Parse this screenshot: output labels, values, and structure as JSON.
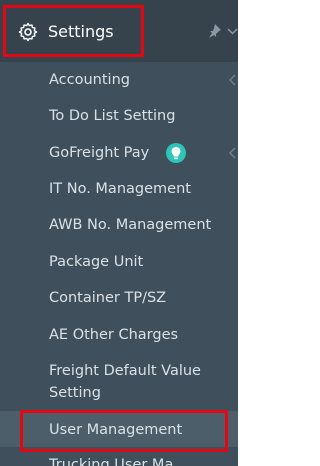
{
  "header": {
    "title": "Settings",
    "icon": "gear-icon",
    "pin_icon": "pin-icon"
  },
  "menu": {
    "items": [
      {
        "label": "Accounting",
        "has_submenu": true
      },
      {
        "label": "To Do List Setting"
      },
      {
        "label": "GoFreight Pay",
        "badge_icon": "lightbulb-icon",
        "badge_color": "#2ec4b6",
        "has_submenu": true
      },
      {
        "label": "IT No. Management"
      },
      {
        "label": "AWB No. Management"
      },
      {
        "label": "Package Unit"
      },
      {
        "label": "Container TP/SZ"
      },
      {
        "label": "AE Other Charges"
      },
      {
        "label": "Freight Default Value"
      },
      {
        "label": "Setting"
      },
      {
        "label": "User Management",
        "active": true
      },
      {
        "label": "Trucking User Ma"
      }
    ]
  },
  "colors": {
    "panel_bg": "#3f4f5b",
    "header_bg": "#36434d",
    "highlight_border": "#e30613",
    "active_bg": "#4d5e6b",
    "text": "#d9e1e6"
  }
}
